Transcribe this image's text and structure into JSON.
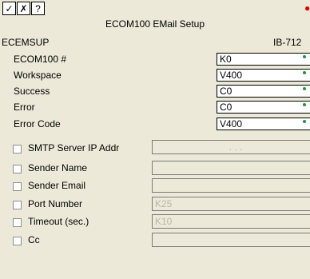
{
  "toolbar": {
    "buttons": [
      {
        "name": "accept-button",
        "glyph": "✓"
      },
      {
        "name": "cancel-button",
        "glyph": "✗"
      },
      {
        "name": "help-button",
        "glyph": "?"
      }
    ],
    "close_glyph": "●"
  },
  "dialog": {
    "title": "ECOM100 EMail Setup",
    "instruction": "ECEMSUP",
    "code": "IB-712"
  },
  "params": [
    {
      "label": "ECOM100 #",
      "value": "K0"
    },
    {
      "label": "Workspace",
      "value": "V400"
    },
    {
      "label": "Success",
      "value": "C0"
    },
    {
      "label": "Error",
      "value": "C0"
    },
    {
      "label": "Error Code",
      "value": "V400"
    }
  ],
  "options": [
    {
      "label": "SMTP Server IP Addr",
      "value": ".       .       .",
      "checked": false
    },
    {
      "label": "Sender Name",
      "value": "",
      "checked": false
    },
    {
      "label": "Sender Email",
      "value": "",
      "checked": false
    },
    {
      "label": "Port Number",
      "value": "K25",
      "checked": false
    },
    {
      "label": "Timeout (sec.)",
      "value": "K10",
      "checked": false
    },
    {
      "label": "Cc",
      "value": "",
      "checked": false
    }
  ],
  "colors": {
    "background": "#ece9d8",
    "field_background": "#ffffff",
    "indicator": "#1a9a3a",
    "close_indicator": "#d40000",
    "disabled_text": "#b9b6a8"
  }
}
